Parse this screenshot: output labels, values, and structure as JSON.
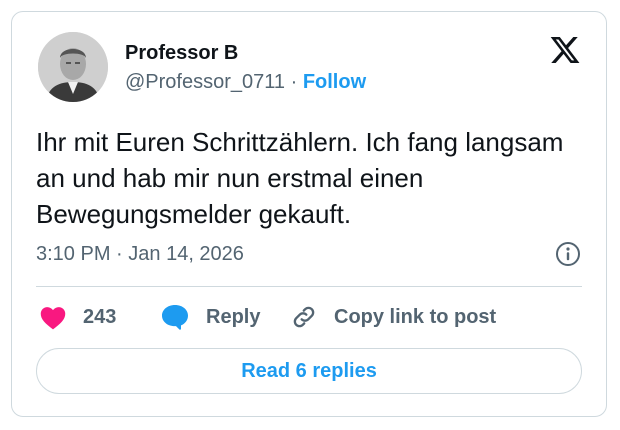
{
  "author": {
    "name": "Professor B",
    "handle": "@Professor_0711",
    "separator": " · ",
    "follow_label": "Follow"
  },
  "tweet": {
    "text": "Ihr mit Euren Schrittzählern. Ich fang langsam an und hab mir nun erstmal einen Bewegungsmelder gekauft.",
    "time": "3:10 PM",
    "date_separator": " · ",
    "date": "Jan 14, 2026"
  },
  "actions": {
    "like_count": "243",
    "reply_label": "Reply",
    "copy_link_label": "Copy link to post"
  },
  "read_replies_label": "Read 6 replies",
  "colors": {
    "accent": "#1d9bf0",
    "like": "#f91880",
    "muted_text": "#536471",
    "border": "#cfd9de"
  },
  "icons": [
    "x-logo-icon",
    "info-icon",
    "heart-icon",
    "reply-bubble-icon",
    "link-icon"
  ]
}
